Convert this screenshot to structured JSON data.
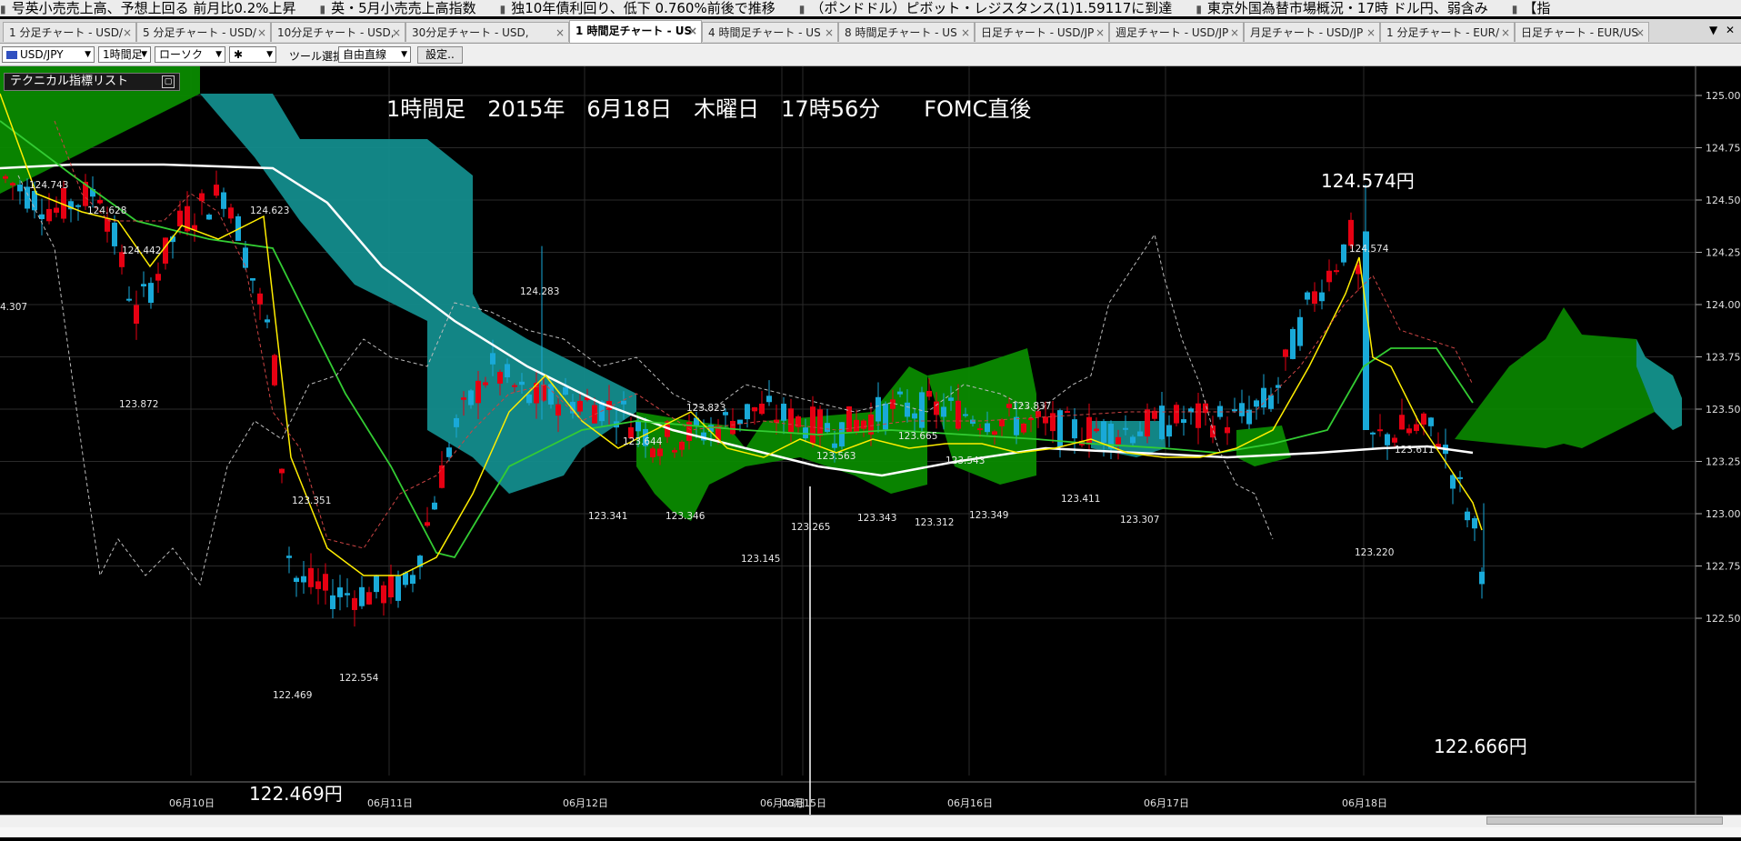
{
  "ticker": [
    "号英小売売上高、予想上回る 前月比0.2%上昇",
    "英・5月小売売上高指数",
    "独10年債利回り、低下 0.760%前後で推移",
    "（ポンドドル）ピボット・レジスタンス(1)1.59117に到達",
    "東京外国為替市場概況・17時 ドル円、弱含み",
    "【指"
  ],
  "tabs": [
    {
      "label": "1 分足チャート - USD/"
    },
    {
      "label": "5 分足チャート - USD/"
    },
    {
      "label": "10分足チャート - USD,"
    },
    {
      "label": "30分足チャート - USD,"
    },
    {
      "label": "1 時間足チャート - US"
    },
    {
      "label": "4 時間足チャート - US"
    },
    {
      "label": "8 時間足チャート - US"
    },
    {
      "label": "日足チャート - USD/JP"
    },
    {
      "label": "週足チャート - USD/JP"
    },
    {
      "label": "月足チャート - USD/JP"
    },
    {
      "label": "1 分足チャート - EUR/"
    },
    {
      "label": "日足チャート - EUR/US"
    }
  ],
  "toolbar": {
    "pair": "USD/JPY",
    "timeframe": "1時間足",
    "chart_type": "ローソク",
    "draw_tool_label": "ツール選択",
    "draw_tool": "自由直線",
    "settings": "設定..",
    "indicator_list": "テクニカル指標リスト"
  },
  "colors": {
    "bull": "#e60012",
    "bear": "#19a9d8",
    "cloud_green": "#0a8a00",
    "cloud_teal": "#138c8c",
    "ma_white": "#ffffff",
    "ma_yellow": "#ffee00",
    "ma_green": "#33cc33"
  },
  "chart_data": {
    "type": "candlestick",
    "instrument": "USD/JPY",
    "period": "1時間足",
    "title": "1時間足　2015年　6月18日　木曜日　17時56分　　FOMC直後",
    "ylim": [
      122.5,
      125.0
    ],
    "y_ticks": [
      "125.00",
      "124.75",
      "124.50",
      "124.25",
      "124.00",
      "123.75",
      "123.50",
      "123.25",
      "123.00",
      "122.75",
      "122.50"
    ],
    "x_labels": [
      "06月10日",
      "06月11日",
      "06月12日",
      "06月13日",
      "06月15日",
      "06月16日",
      "06月17日",
      "06月18日"
    ],
    "annotations": {
      "high_big": "124.574円",
      "low_big_left": "122.469円",
      "low_big_right": "122.666円"
    },
    "price_labels": [
      "124.743",
      "124.628",
      "124.623",
      "124.442",
      "4.307",
      "123.872",
      "124.283",
      "123.351",
      "122.554",
      "122.469",
      "123.823",
      "123.644",
      "123.341",
      "123.346",
      "123.563",
      "123.665",
      "123.543",
      "123.837",
      "123.343",
      "123.312",
      "123.349",
      "123.265",
      "123.145",
      "123.411",
      "123.307",
      "124.574",
      "123.611",
      "123.220"
    ]
  }
}
